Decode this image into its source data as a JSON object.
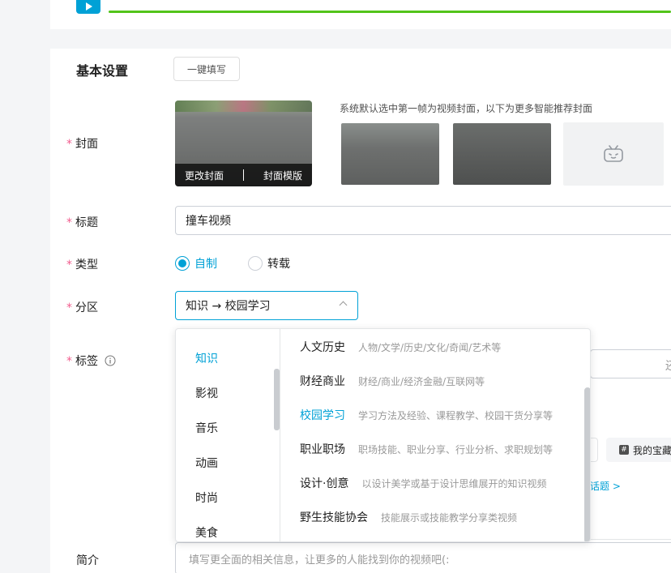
{
  "form": {
    "section_title": "基本设置",
    "quick_fill_label": "一键填写",
    "required_mark": "*",
    "labels": {
      "cover": "封面",
      "title": "标题",
      "type": "类型",
      "zone": "分区",
      "tags": "标签",
      "description": "简介"
    },
    "cover": {
      "change_label": "更改封面",
      "template_label": "封面模版",
      "hint": "系统默认选中第一帧为视频封面，以下为更多智能推荐封面"
    },
    "title_value": "撞车视频",
    "type_options": [
      "自制",
      "转载"
    ],
    "type_selected": "自制",
    "zone_value": "知识 → 校园学习",
    "tags": {
      "partial_button": "还",
      "my_tag_label": "我的宝藏",
      "topic_link": "话题 >"
    },
    "description_placeholder": "填写更全面的相关信息，让更多的人能找到你的视频吧(:"
  },
  "dropdown": {
    "categories": [
      "知识",
      "影视",
      "音乐",
      "动画",
      "时尚",
      "美食"
    ],
    "active_category": "知识",
    "subcategories": [
      {
        "name": "人文历史",
        "desc": "人物/文学/历史/文化/奇闻/艺术等"
      },
      {
        "name": "财经商业",
        "desc": "财经/商业/经济金融/互联网等"
      },
      {
        "name": "校园学习",
        "desc": "学习方法及经验、课程教学、校园干货分享等"
      },
      {
        "name": "职业职场",
        "desc": "职场技能、职业分享、行业分析、求职规划等"
      },
      {
        "name": "设计·创意",
        "desc": "以设计美学或基于设计思维展开的知识视频"
      },
      {
        "name": "野生技能协会",
        "desc": "技能展示或技能教学分享类视频"
      }
    ],
    "active_subcategory": "校园学习"
  },
  "colors": {
    "accent": "#00a1d6",
    "required": "#f25d8e",
    "progress": "#52c41a"
  },
  "upload_progress": 1.0
}
